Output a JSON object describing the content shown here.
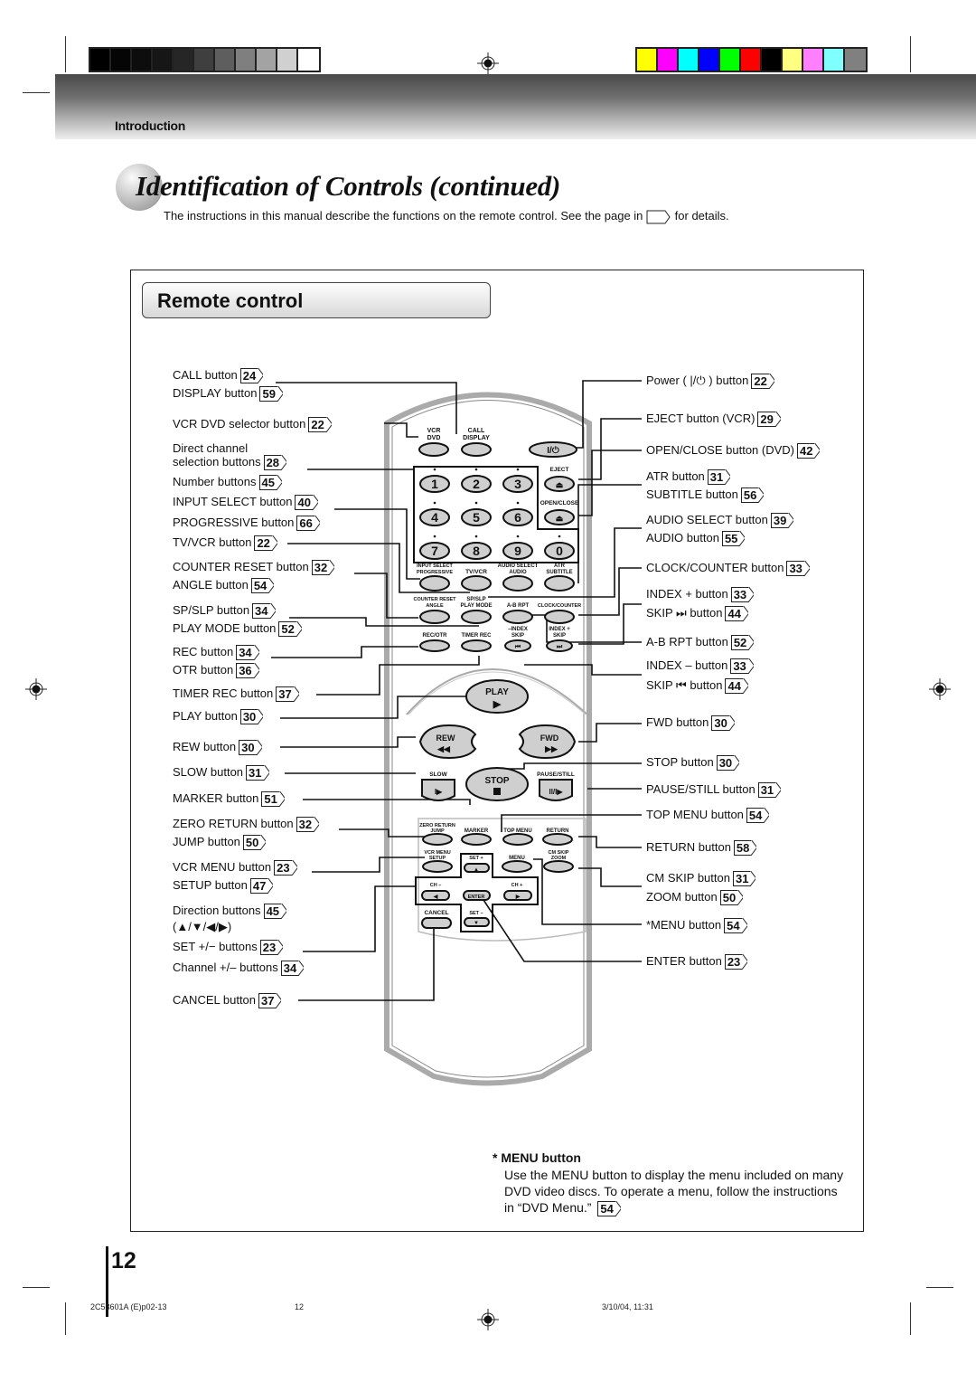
{
  "header": {
    "section_label": "Introduction",
    "gray_swatches": [
      "#000000",
      "#050505",
      "#0d0d0d",
      "#161616",
      "#262626",
      "#3f3f3f",
      "#5e5e5e",
      "#7f7f7f",
      "#a3a3a3",
      "#d0d0d0",
      "#ffffff"
    ],
    "color_swatches": [
      "#ffff00",
      "#ff00ff",
      "#00ffff",
      "#0000ff",
      "#00ff00",
      "#ff0000",
      "#000000",
      "#ffff80",
      "#ff80ff",
      "#80ffff",
      "#808080"
    ]
  },
  "page": {
    "title": "Identification of Controls (continued)",
    "intro_before": "The instructions in this manual describe the functions on the remote control. See the page in",
    "intro_after": "for details.",
    "section_title": "Remote control",
    "page_number": "12"
  },
  "left_callouts": [
    {
      "text": "CALL button",
      "page": "24"
    },
    {
      "text": "DISPLAY button",
      "page": "59"
    },
    {
      "text": "VCR DVD selector button",
      "page": "22"
    },
    {
      "text": "Direct channel",
      "page": ""
    },
    {
      "text": "selection buttons",
      "page": "28"
    },
    {
      "text": "Number buttons",
      "page": "45"
    },
    {
      "text": "INPUT SELECT button",
      "page": "40"
    },
    {
      "text": "PROGRESSIVE button",
      "page": "66"
    },
    {
      "text": "TV/VCR button",
      "page": "22"
    },
    {
      "text": "COUNTER RESET button",
      "page": "32"
    },
    {
      "text": "ANGLE button",
      "page": "54"
    },
    {
      "text": "SP/SLP button",
      "page": "34"
    },
    {
      "text": "PLAY MODE button",
      "page": "52"
    },
    {
      "text": "REC button",
      "page": "34"
    },
    {
      "text": "OTR button",
      "page": "36"
    },
    {
      "text": "TIMER REC button",
      "page": "37"
    },
    {
      "text": "PLAY button",
      "page": "30"
    },
    {
      "text": "REW button",
      "page": "30"
    },
    {
      "text": "SLOW button",
      "page": "31"
    },
    {
      "text": "MARKER button",
      "page": "51"
    },
    {
      "text": "ZERO RETURN button",
      "page": "32"
    },
    {
      "text": "JUMP button",
      "page": "50"
    },
    {
      "text": "VCR MENU button",
      "page": "23"
    },
    {
      "text": "SETUP button",
      "page": "47"
    },
    {
      "text": "Direction buttons",
      "page": "45"
    },
    {
      "text": "(▲/▼/◀/▶)",
      "page": ""
    },
    {
      "text": "SET +/− buttons",
      "page": "23"
    },
    {
      "text": "Channel +/– buttons",
      "page": "34"
    },
    {
      "text": "CANCEL button",
      "page": "37"
    }
  ],
  "right_callouts": [
    {
      "text": "Power ( |/⏻ ) button",
      "page": "22"
    },
    {
      "text": "EJECT button (VCR)",
      "page": "29"
    },
    {
      "text": "OPEN/CLOSE button (DVD)",
      "page": "42"
    },
    {
      "text": "ATR button",
      "page": "31"
    },
    {
      "text": "SUBTITLE button",
      "page": "56"
    },
    {
      "text": "AUDIO SELECT button",
      "page": "39"
    },
    {
      "text": "AUDIO button",
      "page": "55"
    },
    {
      "text": "CLOCK/COUNTER button",
      "page": "33"
    },
    {
      "text": "INDEX + button",
      "page": "33"
    },
    {
      "text": "SKIP ⏭ button",
      "page": "44"
    },
    {
      "text": "A-B RPT button",
      "page": "52"
    },
    {
      "text": "INDEX – button",
      "page": "33"
    },
    {
      "text": "SKIP ⏮ button",
      "page": "44"
    },
    {
      "text": "FWD button",
      "page": "30"
    },
    {
      "text": "STOP button",
      "page": "30"
    },
    {
      "text": "PAUSE/STILL button",
      "page": "31"
    },
    {
      "text": "TOP MENU button",
      "page": "54"
    },
    {
      "text": "RETURN button",
      "page": "58"
    },
    {
      "text": "CM SKIP button",
      "page": "31"
    },
    {
      "text": "ZOOM button",
      "page": "50"
    },
    {
      "text": "*MENU button",
      "page": "54"
    },
    {
      "text": "ENTER button",
      "page": "23"
    }
  ],
  "remote": {
    "vcr": "VCR",
    "dvd": "DVD",
    "call": "CALL",
    "display": "DISPLAY",
    "power": "I/⏻",
    "eject": "EJECT",
    "open_close": "OPEN/CLOSE",
    "eject_glyph": "⏏",
    "digits": [
      "1",
      "2",
      "3",
      "4",
      "5",
      "6",
      "7",
      "8",
      "9",
      "0"
    ],
    "input_select": "INPUT SELECT",
    "progressive": "PROGRESSIVE",
    "tv_vcr": "TV/VCR",
    "audio_select": "AUDIO SELECT",
    "audio": "AUDIO",
    "atr": "ATR",
    "subtitle": "SUBTITLE",
    "counter_reset": "COUNTER RESET",
    "angle": "ANGLE",
    "sp_slp": "SP/SLP",
    "play_mode": "PLAY MODE",
    "ab_rpt": "A-B RPT",
    "clock_counter": "CLOCK/COUNTER",
    "rec_otr": "REC/OTR",
    "timer_rec": "TIMER REC",
    "index_minus": "–INDEX",
    "skip": "SKIP",
    "index_plus": "INDEX +",
    "play": "PLAY",
    "rew": "REW",
    "fwd": "FWD",
    "slow": "SLOW",
    "stop": "STOP",
    "pause_still": "PAUSE/STILL",
    "zero_return": "ZERO RETURN",
    "jump": "JUMP",
    "marker": "MARKER",
    "top_menu": "TOP MENU",
    "return": "RETURN",
    "vcr_menu": "VCR MENU",
    "setup": "SETUP",
    "set_plus": "SET +",
    "menu": "MENU",
    "cm_skip": "CM SKIP",
    "zoom": "ZOOM",
    "ch_minus": "CH –",
    "ch_plus": "CH +",
    "enter": "ENTER",
    "cancel": "CANCEL",
    "set_minus": "SET –"
  },
  "note": {
    "title": "*  MENU button",
    "body": "Use the MENU button to display the menu included on many DVD video discs. To operate a menu, follow the instructions in “DVD Menu.”",
    "page": "54"
  },
  "footer": {
    "doc_code": "2C53601A (E)p02-13",
    "page": "12",
    "timestamp": "3/10/04, 11:31"
  }
}
